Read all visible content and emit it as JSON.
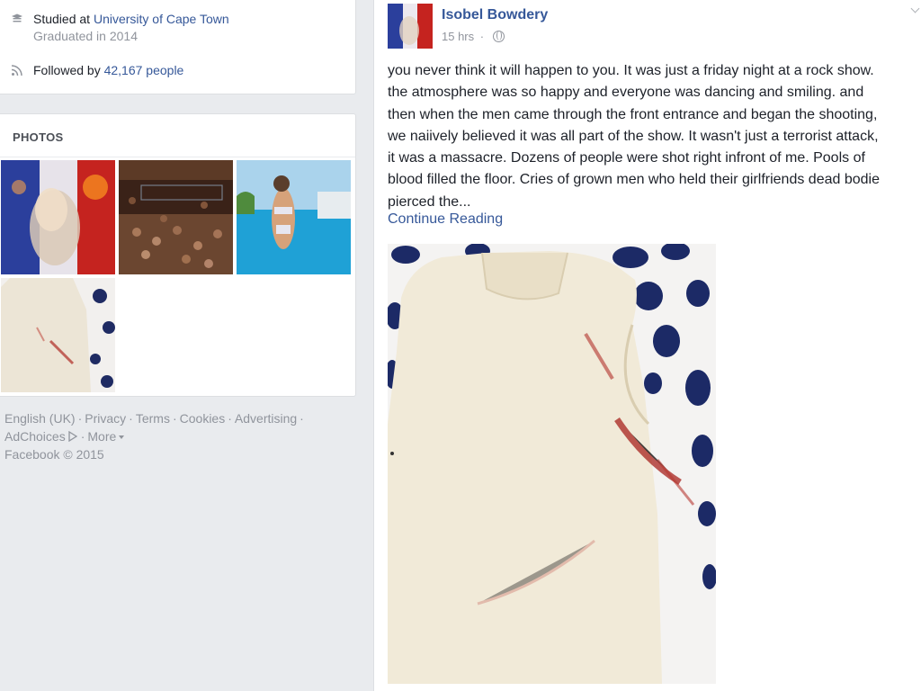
{
  "intro": {
    "education": {
      "prefix": "Studied at",
      "school": "University of Cape Town",
      "graduated": "Graduated in 2014",
      "icon": "graduation-cap-icon"
    },
    "followers": {
      "prefix": "Followed by",
      "count": "42,167 people",
      "icon": "rss-feed-icon"
    }
  },
  "photos": {
    "title": "PHOTOS",
    "items": [
      {
        "alt": "profile photo with french flag overlay"
      },
      {
        "alt": "concert crowd"
      },
      {
        "alt": "woman in pool"
      },
      {
        "alt": "bloodstained white top"
      }
    ]
  },
  "footer": {
    "links": [
      "English (UK)",
      "Privacy",
      "Terms",
      "Cookies",
      "Advertising",
      "AdChoices",
      "More"
    ],
    "copyright": "Facebook © 2015"
  },
  "post": {
    "author": "Isobel Bowdery",
    "time": "15 hrs",
    "audience_icon": "globe-icon",
    "lines": [
      "you never think it will happen to you. It was just a friday night at a rock show.",
      "the atmosphere was so happy and everyone was dancing and smiling. and",
      "then when the men came through the front entrance and began the shooting,",
      "we naiively believed it was all part of the show. It wasn't just a terrorist attack,",
      "it was a massacre. Dozens of people were shot right infront of me. Pools of",
      "blood filled the floor. Cries of grown men who held their girlfriends dead bodie",
      "pierced the..."
    ],
    "continue_label": "Continue Reading"
  },
  "colors": {
    "link": "#365899",
    "muted": "#90949c",
    "background": "#e9ebee"
  }
}
